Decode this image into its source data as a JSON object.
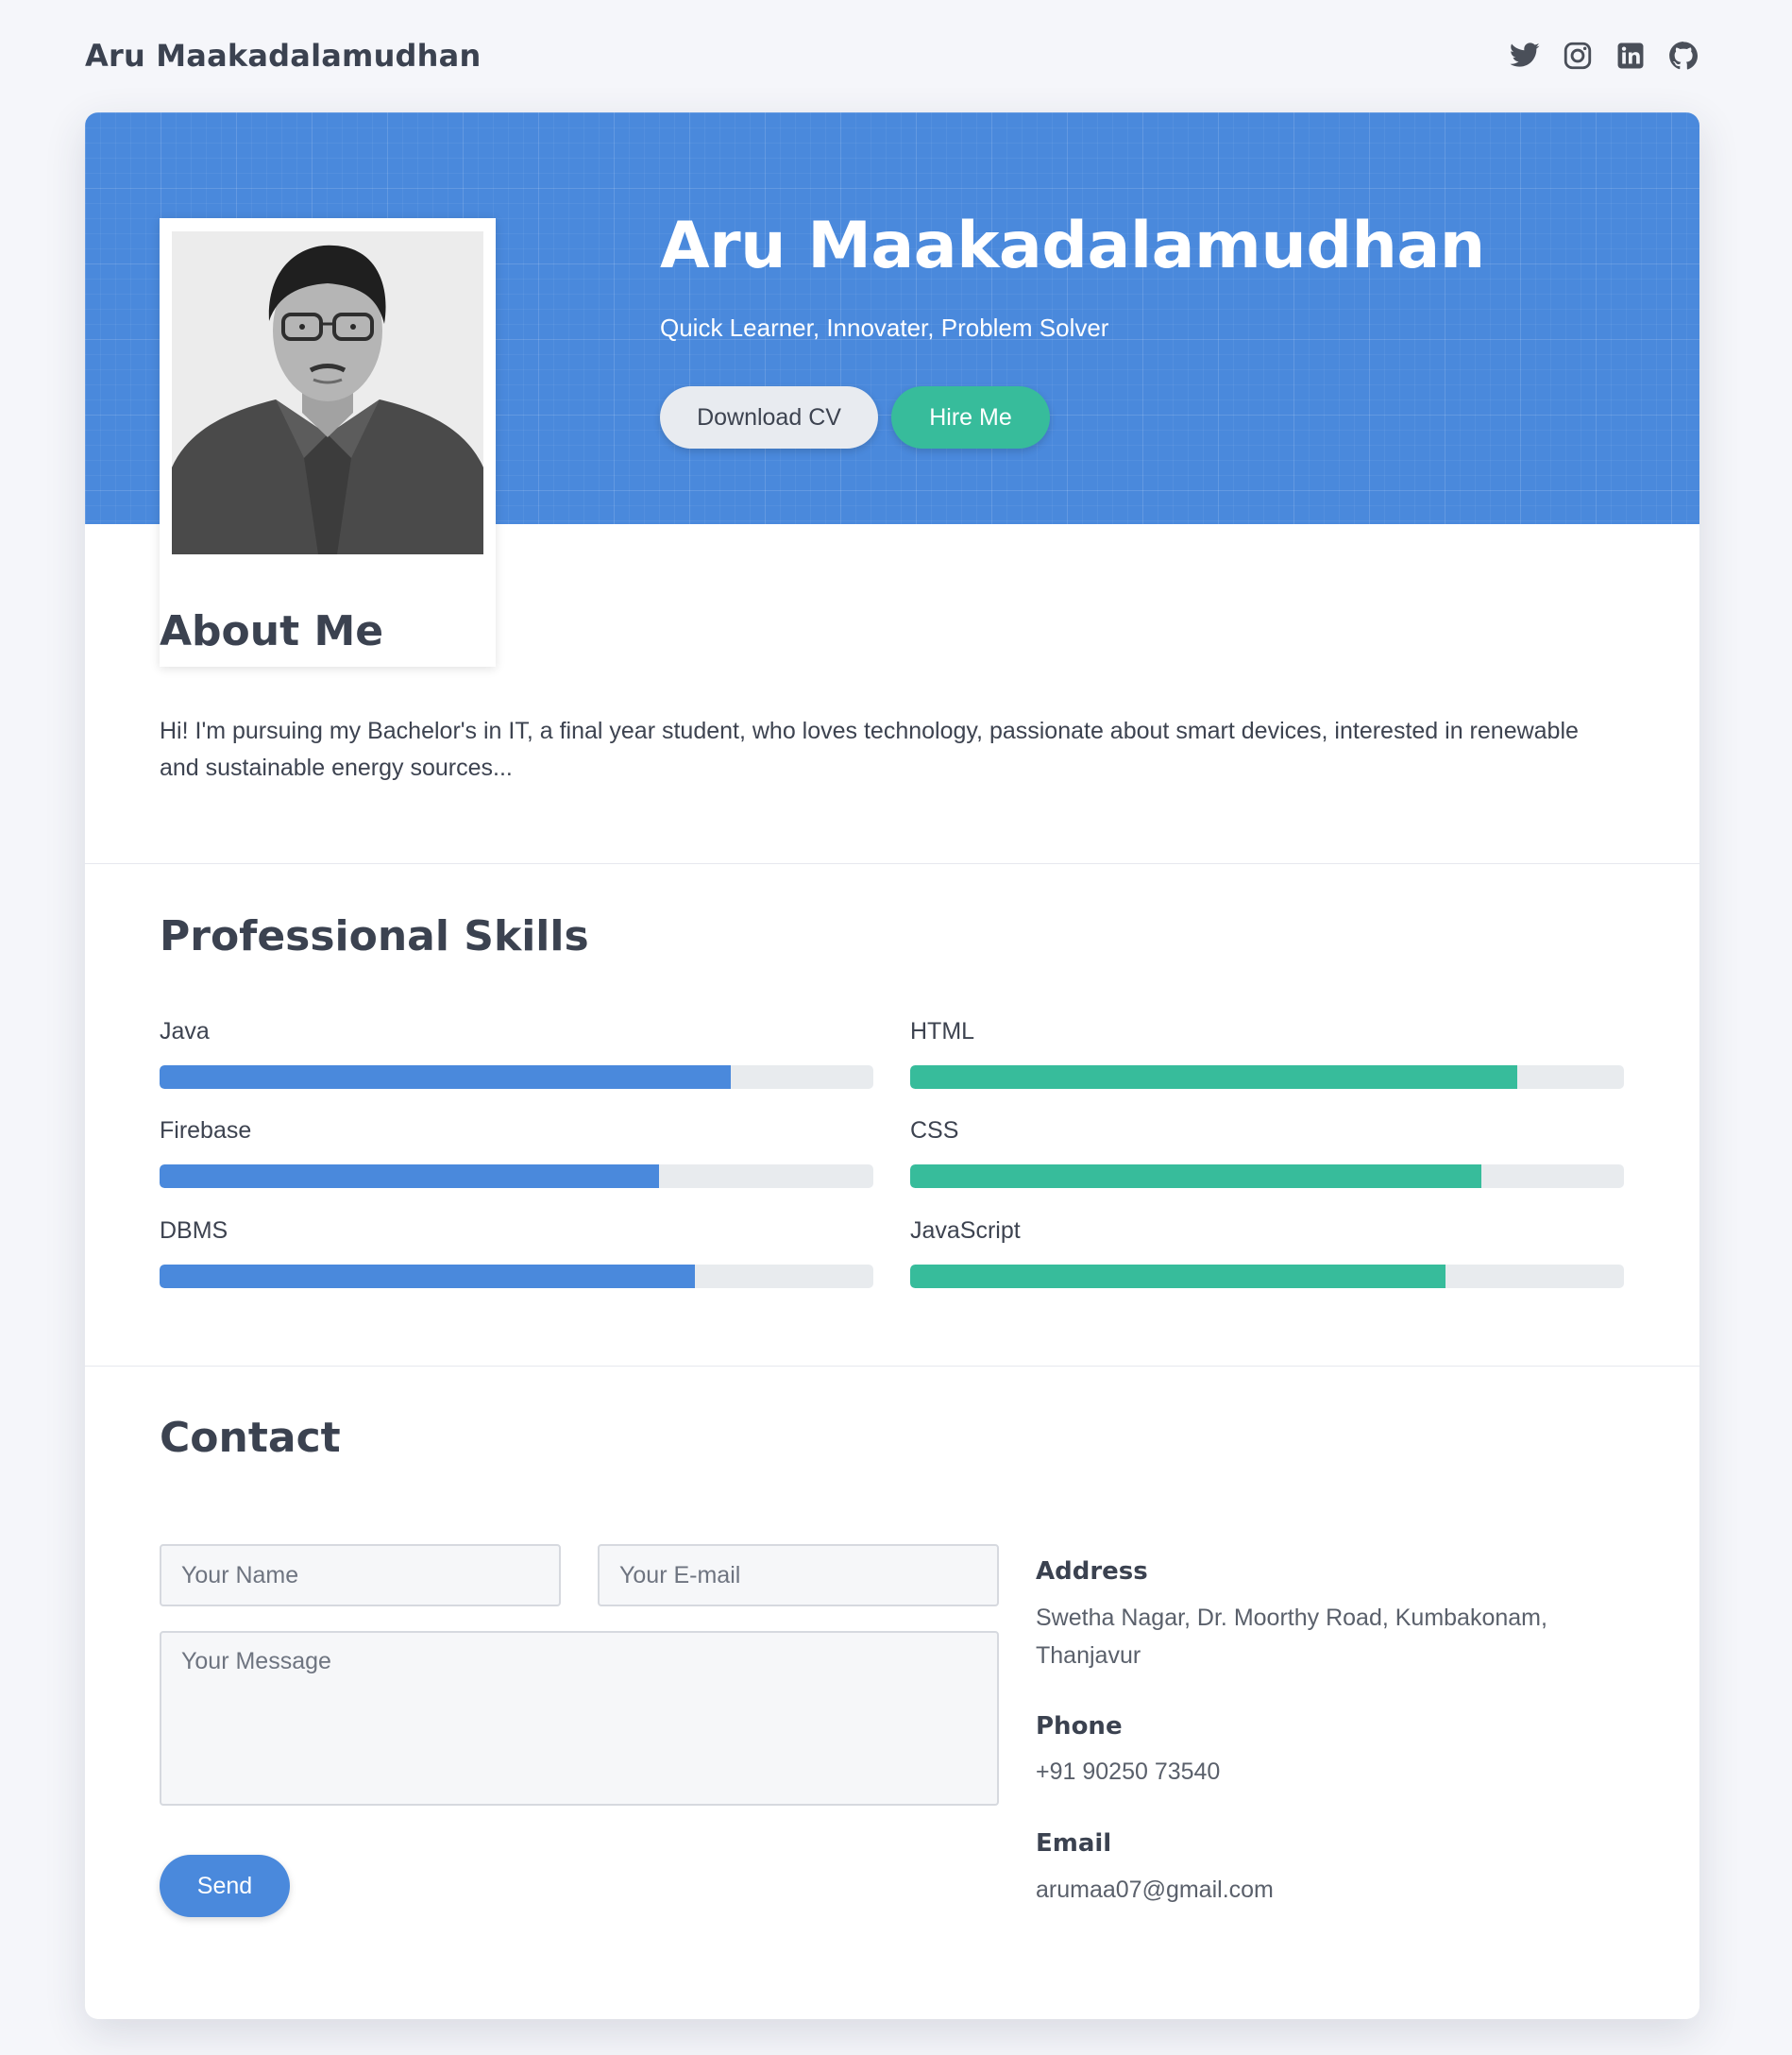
{
  "header": {
    "brand": "Aru Maakadalamudhan",
    "socials": [
      {
        "icon": "twitter-icon"
      },
      {
        "icon": "instagram-icon"
      },
      {
        "icon": "linkedin-icon"
      },
      {
        "icon": "github-icon"
      }
    ]
  },
  "hero": {
    "name": "Aru Maakadalamudhan",
    "tagline": "Quick Learner, Innovater, Problem Solver",
    "download_label": "Download CV",
    "hire_label": "Hire Me"
  },
  "about": {
    "title": "About Me",
    "text": "Hi! I'm pursuing my Bachelor's in IT, a final year student, who loves technology, passionate about smart devices, interested in renewable and sustainable energy sources..."
  },
  "skills": {
    "title": "Professional Skills",
    "left": [
      {
        "name": "Java",
        "level": 0.8
      },
      {
        "name": "Firebase",
        "level": 0.7
      },
      {
        "name": "DBMS",
        "level": 0.75
      }
    ],
    "right": [
      {
        "name": "HTML",
        "level": 0.85
      },
      {
        "name": "CSS",
        "level": 0.8
      },
      {
        "name": "JavaScript",
        "level": 0.75
      }
    ]
  },
  "contact": {
    "title": "Contact",
    "name_placeholder": "Your Name",
    "email_placeholder": "Your E-mail",
    "message_placeholder": "Your Message",
    "send_label": "Send",
    "address_label": "Address",
    "address": "Swetha Nagar, Dr. Moorthy Road, Kumbakonam, Thanjavur",
    "phone_label": "Phone",
    "phone": "+91 90250 73540",
    "email_label": "Email",
    "email": "arumaa07@gmail.com"
  },
  "colors": {
    "primary": "#4a89dc",
    "accent": "#37bc9b",
    "background": "#f5f6fa"
  }
}
